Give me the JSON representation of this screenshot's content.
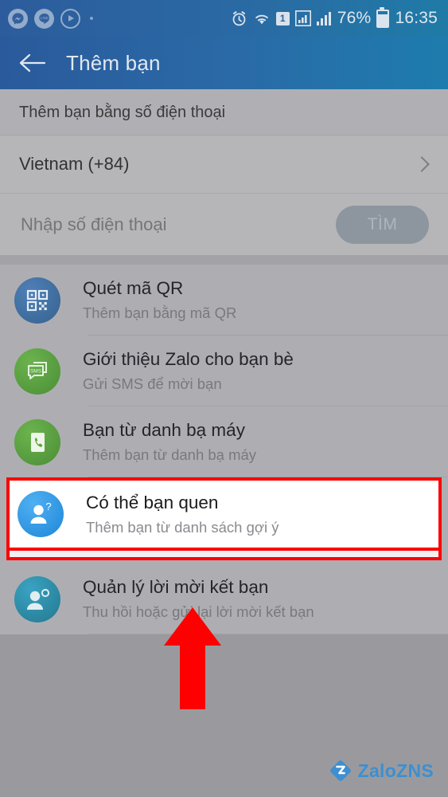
{
  "status_bar": {
    "left_icons": [
      "messenger-icon",
      "line-icon",
      "media-player-icon",
      "notification-dot"
    ],
    "right_icons": [
      "alarm-icon",
      "wifi-icon",
      "sim1-badge",
      "signal-icon-1",
      "signal-icon-2",
      "battery-icon"
    ],
    "sim_label": "1",
    "battery_percent": "76%",
    "clock": "16:35"
  },
  "app_bar": {
    "back_icon": "back-arrow-icon",
    "title": "Thêm bạn"
  },
  "phone_section": {
    "heading": "Thêm bạn bằng số điện thoại",
    "country": {
      "label": "Vietnam (+84)",
      "chevron_icon": "chevron-right-icon"
    },
    "phone_input_placeholder": "Nhập số điện thoại",
    "phone_input_value": "",
    "find_button_label": "TÌM"
  },
  "options": [
    {
      "icon": "qr-code-icon",
      "icon_color": "#3d6fa8",
      "title": "Quét mã QR",
      "subtitle": "Thêm bạn bằng mã QR",
      "highlighted": false
    },
    {
      "icon": "sms-bubble-icon",
      "icon_color": "#56a13d",
      "title": "Giới thiệu Zalo cho bạn bè",
      "subtitle": "Gửi SMS để mời bạn",
      "highlighted": false
    },
    {
      "icon": "phone-contacts-icon",
      "icon_color": "#56a13d",
      "title": "Bạn từ danh bạ máy",
      "subtitle": "Thêm bạn từ danh bạ máy",
      "highlighted": false
    },
    {
      "icon": "person-question-icon",
      "icon_color": "#2f97e8",
      "title": "Có thể bạn quen",
      "subtitle": "Thêm bạn từ danh sách gợi ý",
      "highlighted": true
    },
    {
      "icon": "person-gear-icon",
      "icon_color": "#2d8aa8",
      "title": "Quản lý lời mời kết bạn",
      "subtitle": "Thu hồi hoặc gửi lại lời mời kết bạn",
      "highlighted": false
    }
  ],
  "annotations": {
    "arrow_icon": "red-up-arrow",
    "arrow_color": "#ff0000",
    "highlight_border_color": "#ff0000"
  },
  "watermark": {
    "logo_icon": "zalo-diamond-z-logo",
    "text": "ZaloZNS",
    "color": "#3d8fd1"
  },
  "colors": {
    "header_start": "#2a5a9b",
    "header_end": "#1d7cad",
    "page_background": "#9a9a9e"
  }
}
